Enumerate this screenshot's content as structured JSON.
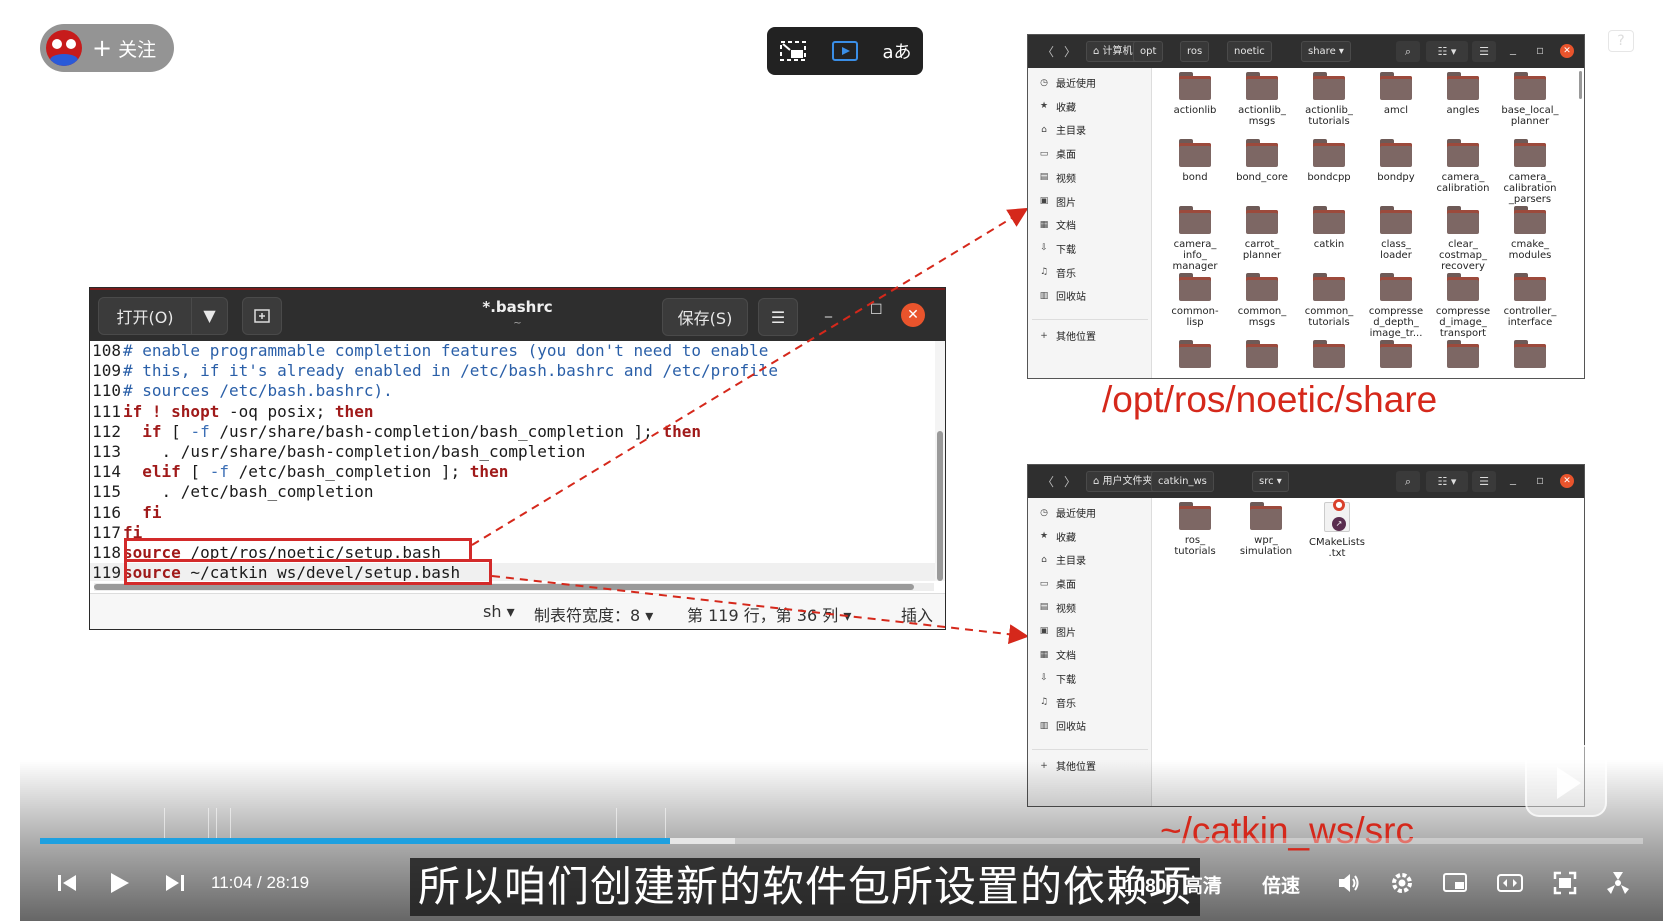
{
  "follow": {
    "label": "关注",
    "plus": "+"
  },
  "video_tools": {
    "icons": [
      "minimize-window-icon",
      "play-screen-icon",
      "translate-icon"
    ],
    "translate_glyph": "aあ"
  },
  "help_glyph": "?",
  "gedit": {
    "open_label": "打开(O)",
    "title": "*.bashrc",
    "subtitle": "~",
    "save_label": "保存(S)",
    "menu_glyph": "☰",
    "minimize_glyph": "_",
    "maximize_glyph": "☐",
    "close_glyph": "✕",
    "lines": [
      {
        "n": "108",
        "parts": [
          [
            "c-com",
            "# enable programmable completion features (you don't need to enable"
          ]
        ]
      },
      {
        "n": "109",
        "parts": [
          [
            "c-com",
            "# this, if it's already enabled in /etc/bash.bashrc and /etc/profile"
          ]
        ]
      },
      {
        "n": "110",
        "parts": [
          [
            "c-com",
            "# sources /etc/bash.bashrc)."
          ]
        ]
      },
      {
        "n": "111",
        "parts": [
          [
            "c-kw",
            "if ! shopt"
          ],
          [
            "",
            " -oq posix; "
          ],
          [
            "c-kw",
            "then"
          ]
        ]
      },
      {
        "n": "112",
        "parts": [
          [
            "",
            "  "
          ],
          [
            "c-kw",
            "if"
          ],
          [
            "",
            " [ "
          ],
          [
            "c-op",
            "-f"
          ],
          [
            "",
            " /usr/share/bash-completion/bash_completion ]; "
          ],
          [
            "c-kw",
            "then"
          ]
        ]
      },
      {
        "n": "113",
        "parts": [
          [
            "",
            "    . /usr/share/bash-completion/bash_completion"
          ]
        ]
      },
      {
        "n": "114",
        "parts": [
          [
            "",
            "  "
          ],
          [
            "c-kw",
            "elif"
          ],
          [
            "",
            " [ "
          ],
          [
            "c-op",
            "-f"
          ],
          [
            "",
            " /etc/bash_completion ]; "
          ],
          [
            "c-kw",
            "then"
          ]
        ]
      },
      {
        "n": "115",
        "parts": [
          [
            "",
            "    . /etc/bash_completion"
          ]
        ]
      },
      {
        "n": "116",
        "parts": [
          [
            "",
            "  "
          ],
          [
            "c-kw",
            "fi"
          ]
        ]
      },
      {
        "n": "117",
        "parts": [
          [
            "c-kw",
            "fi"
          ]
        ]
      },
      {
        "n": "118",
        "parts": [
          [
            "c-kw",
            "source"
          ],
          [
            "",
            " /opt/ros/noetic/setup.bash"
          ]
        ]
      },
      {
        "n": "119",
        "parts": [
          [
            "c-kw",
            "source"
          ],
          [
            "",
            " ~/catkin_ws/devel/setup.bash"
          ]
        ],
        "current": true
      }
    ],
    "status": {
      "lang": "sh ▾",
      "tab_width": "制表符宽度：8 ▾",
      "position": "第 119 行，第 36 列 ▾",
      "mode": "插入"
    }
  },
  "fm_share": {
    "crumbs": [
      "计算机",
      "opt",
      "ros",
      "noetic",
      "share ▾"
    ],
    "sidebar": [
      "最近使用",
      "收藏",
      "主目录",
      "桌面",
      "视频",
      "图片",
      "文档",
      "下载",
      "音乐",
      "回收站",
      "其他位置"
    ],
    "sidebar_icons": [
      "clock-icon",
      "star-icon",
      "home-icon",
      "desktop-icon",
      "video-icon",
      "image-icon",
      "document-icon",
      "download-icon",
      "music-icon",
      "trash-icon",
      "plus-icon"
    ],
    "sidebar_glyphs": [
      "◷",
      "★",
      "⌂",
      "▭",
      "▤",
      "▣",
      "▦",
      "⇩",
      "♫",
      "▥",
      "+"
    ],
    "files": [
      [
        "actionlib"
      ],
      [
        "actionlib_",
        "msgs"
      ],
      [
        "actionlib_",
        "tutorials"
      ],
      [
        "amcl"
      ],
      [
        "angles"
      ],
      [
        "base_local_",
        "planner"
      ],
      [
        "bond"
      ],
      [
        "bond_core"
      ],
      [
        "bondcpp"
      ],
      [
        "bondpy"
      ],
      [
        "camera_",
        "calibration"
      ],
      [
        "camera_",
        "calibration",
        "_parsers"
      ],
      [
        "camera_",
        "info_",
        "manager"
      ],
      [
        "carrot_",
        "planner"
      ],
      [
        "catkin"
      ],
      [
        "class_",
        "loader"
      ],
      [
        "clear_",
        "costmap_",
        "recovery"
      ],
      [
        "cmake_",
        "modules"
      ],
      [
        "common-",
        "lisp"
      ],
      [
        "common_",
        "msgs"
      ],
      [
        "common_",
        "tutorials"
      ],
      [
        "compresse",
        "d_depth_",
        "image_tr..."
      ],
      [
        "compresse",
        "d_image_",
        "transport"
      ],
      [
        "controller_",
        "interface"
      ],
      [
        ""
      ],
      [
        ""
      ],
      [
        ""
      ],
      [
        ""
      ],
      [
        ""
      ],
      [
        ""
      ]
    ]
  },
  "fm_src": {
    "crumbs": [
      "用户文件夹",
      "catkin_ws",
      "src ▾"
    ],
    "files": [
      {
        "lines": [
          "ros_",
          "tutorials"
        ],
        "kind": "folder"
      },
      {
        "lines": [
          "wpr_",
          "simulation"
        ],
        "kind": "folder"
      },
      {
        "lines": [
          "CMakeLists",
          ".txt"
        ],
        "kind": "doc"
      }
    ]
  },
  "labels": {
    "share_path": "/opt/ros/noetic/share",
    "src_path": "~/catkin_ws/src"
  },
  "player": {
    "progress_fraction": 0.393,
    "current_time": "11:04",
    "separator": "/",
    "total_time": "28:19",
    "subtitle": "所以咱们创建新的软件包所设置的依赖项",
    "quality": "1080P 高清",
    "speed": "倍速"
  },
  "colors": {
    "accent_red": "#d5281b",
    "progress_blue": "#1ea0e0",
    "close_orange": "#e9542c"
  }
}
